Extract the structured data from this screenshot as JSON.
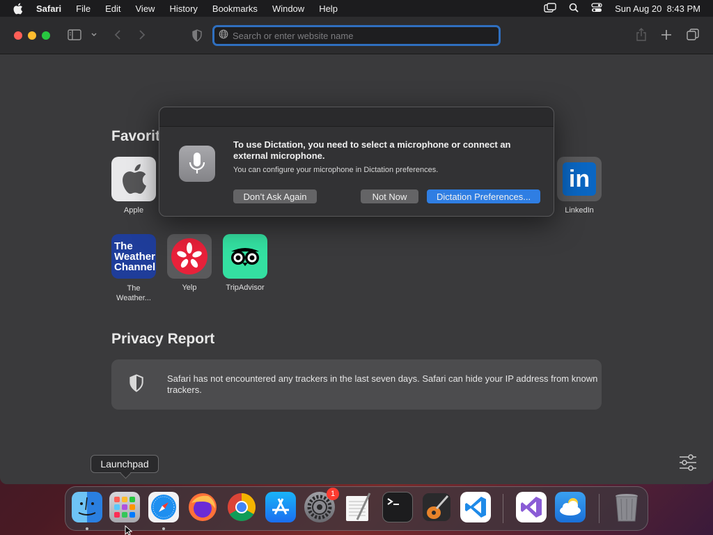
{
  "menubar": {
    "app_name": "Safari",
    "items": [
      "File",
      "Edit",
      "View",
      "History",
      "Bookmarks",
      "Window",
      "Help"
    ],
    "datetime": "Sun Aug 20  8:43 PM"
  },
  "toolbar": {
    "address_placeholder": "Search or enter website name"
  },
  "favorites": {
    "title": "Favorit",
    "items": [
      {
        "label": "Apple"
      },
      {
        "label": "LinkedIn"
      },
      {
        "label": "The Weather..."
      },
      {
        "label": "Yelp"
      },
      {
        "label": "TripAdvisor"
      }
    ],
    "weather_logo_lines": [
      "The",
      "Weather",
      "Channel"
    ],
    "linkedin_logo": "in"
  },
  "privacy": {
    "title": "Privacy Report",
    "message": "Safari has not encountered any trackers in the last seven days. Safari can hide your IP address from known trackers."
  },
  "dialog": {
    "headline": "To use Dictation, you need to select a microphone or connect an external microphone.",
    "subtext": "You can configure your microphone in Dictation preferences.",
    "buttons": {
      "dont_ask": "Don’t Ask Again",
      "not_now": "Not Now",
      "preferences": "Dictation Preferences..."
    }
  },
  "tooltip": {
    "text": "Launchpad"
  },
  "dock": {
    "apps": [
      "Finder",
      "Launchpad",
      "Safari",
      "Firefox",
      "Chrome",
      "App Store",
      "System Settings",
      "TextEdit",
      "Terminal",
      "GarageBand",
      "Visual Studio Code",
      "Visual Studio",
      "Weather",
      "Trash"
    ],
    "settings_badge": "1"
  },
  "colors": {
    "accent": "#2f7ee3",
    "close": "#ff5f57",
    "minimize": "#febc2e",
    "maximize": "#28c840"
  }
}
